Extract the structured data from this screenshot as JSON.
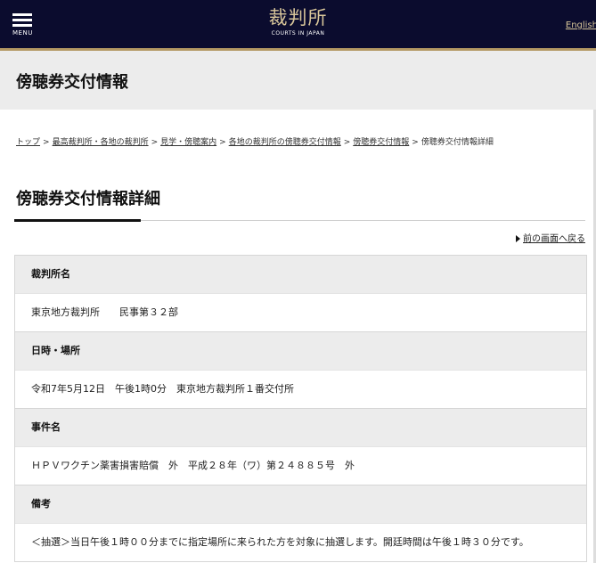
{
  "header": {
    "menu_label": "MENU",
    "logo_kanji": "裁判所",
    "logo_en": "COURTS IN JAPAN",
    "lang_link": "English"
  },
  "page_title": "傍聴券交付情報",
  "breadcrumb": [
    {
      "label": "トップ",
      "link": true
    },
    {
      "label": "最高裁判所・各地の裁判所",
      "link": true
    },
    {
      "label": "見学・傍聴案内",
      "link": true
    },
    {
      "label": "各地の裁判所の傍聴券交付情報",
      "link": true
    },
    {
      "label": "傍聴券交付情報",
      "link": true
    },
    {
      "label": "傍聴券交付情報詳細",
      "link": false
    }
  ],
  "breadcrumb_separator": ">",
  "section_heading": "傍聴券交付情報詳細",
  "back_link": "前の画面へ戻る",
  "details": [
    {
      "label": "裁判所名",
      "value": "東京地方裁判所　　民事第３２部"
    },
    {
      "label": "日時・場所",
      "value": "令和7年5月12日　午後1時0分　東京地方裁判所１番交付所"
    },
    {
      "label": "事件名",
      "value": "ＨＰＶワクチン薬害損害賠償　外　平成２８年（ワ）第２４８８５号　外"
    },
    {
      "label": "備考",
      "value": "＜抽選＞当日午後１時００分までに指定場所に来られた方を対象に抽選します。開廷時間は午後１時３０分です。"
    }
  ],
  "colors": {
    "header_bg": "#0b0c2e",
    "header_accent": "#b39863",
    "label_bg": "#ececec"
  }
}
